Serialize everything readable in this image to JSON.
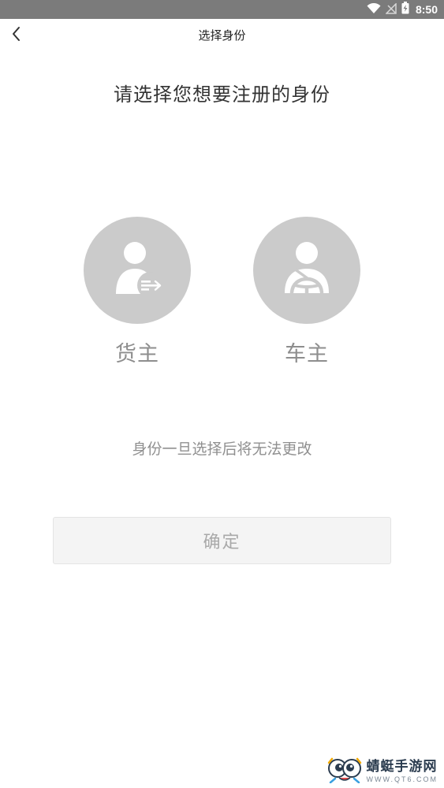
{
  "status_bar": {
    "time": "8:50",
    "icons": [
      "wifi-icon",
      "signal-off-icon",
      "battery-charging-icon"
    ]
  },
  "nav": {
    "back_icon": "chevron-left-icon",
    "title": "选择身份"
  },
  "headline": "请选择您想要注册的身份",
  "roles": [
    {
      "label": "货主",
      "icon": "shipper-icon"
    },
    {
      "label": "车主",
      "icon": "driver-icon"
    }
  ],
  "notice": "身份一旦选择后将无法更改",
  "confirm_label": "确定",
  "watermark": {
    "name": "蜻蜓手游网",
    "url": "WWW.QT6.COM"
  },
  "colors": {
    "status_bar": "#7b7b7b",
    "role_circle": "#cbcbcb",
    "role_label": "#8e8e8e",
    "button_bg": "#f4f4f4",
    "button_text": "#a9a9a9"
  }
}
